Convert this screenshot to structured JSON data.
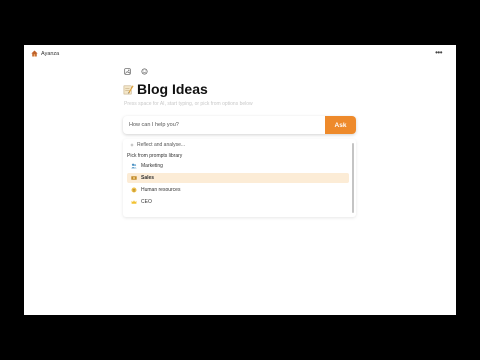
{
  "app": {
    "name": "Ayanza"
  },
  "header": {
    "more_label": "•••"
  },
  "page": {
    "title": "Blog Ideas",
    "subtitle": "Press space for AI, start typing, or pick from options below"
  },
  "ask": {
    "placeholder": "How can I help you?",
    "button_label": "Ask"
  },
  "dropdown": {
    "reflect_label": "Reflect and analyse...",
    "section_header": "Pick from prompts library",
    "items": [
      {
        "label": "Marketing",
        "icon": "people-icon"
      },
      {
        "label": "Sales",
        "icon": "money-icon"
      },
      {
        "label": "Human resources",
        "icon": "face-icon"
      },
      {
        "label": "CEO",
        "icon": "crown-icon"
      }
    ],
    "selected_item": "Sales"
  },
  "colors": {
    "accent": "#ee8a2b",
    "selected_bg": "#fcecd6"
  }
}
